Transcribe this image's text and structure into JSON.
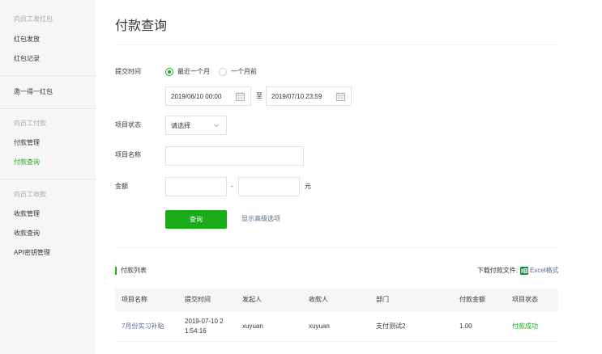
{
  "sidebar": {
    "groups": [
      {
        "title": "向员工发红包",
        "items": [
          "红包发放",
          "红包记录"
        ]
      },
      {
        "title": "",
        "items": [
          "邀一得一红包"
        ]
      },
      {
        "title": "向员工付款",
        "items": [
          "付款管理",
          "付款查询"
        ]
      },
      {
        "title": "向员工收款",
        "items": [
          "收款管理",
          "收款查询",
          "API密钥管理"
        ]
      }
    ],
    "active_item": "付款查询"
  },
  "page": {
    "title": "付款查询"
  },
  "filters": {
    "time_label": "提交时间",
    "radio_options": [
      "最近一个月",
      "一个月前"
    ],
    "radio_selected": "最近一个月",
    "start_datetime": "2019/06/10 00:00",
    "date_separator": "至",
    "end_datetime": "2019/07/10 23:59",
    "status_label": "项目状态",
    "status_select": "请选择",
    "name_label": "项目名称",
    "name_value": "",
    "amount_label": "金额",
    "amount_min": "",
    "amount_dash": "-",
    "amount_max": "",
    "amount_unit": "元",
    "query_button": "查询",
    "advanced_link": "显示高级选项"
  },
  "list": {
    "title": "付款列表",
    "download_label": "下载付款文件:",
    "excel_link": "Excel格式",
    "columns": [
      "项目名称",
      "提交时间",
      "发起人",
      "收款人",
      "部门",
      "付款金额",
      "项目状态"
    ],
    "rows": [
      {
        "name": "7月份实习补贴",
        "time_line1": "2019-07-10 2",
        "time_line2": "1:54:16",
        "initiator": "xuyuan",
        "payee": "xuyuan",
        "department": "支付测试2",
        "amount": "1.00",
        "status": "付款成功"
      }
    ]
  },
  "colors": {
    "accent_green": "#1aad19",
    "link_blue": "#576b95",
    "sidebar_bg": "#f6f6f6",
    "muted_text": "#a8a8a8"
  }
}
